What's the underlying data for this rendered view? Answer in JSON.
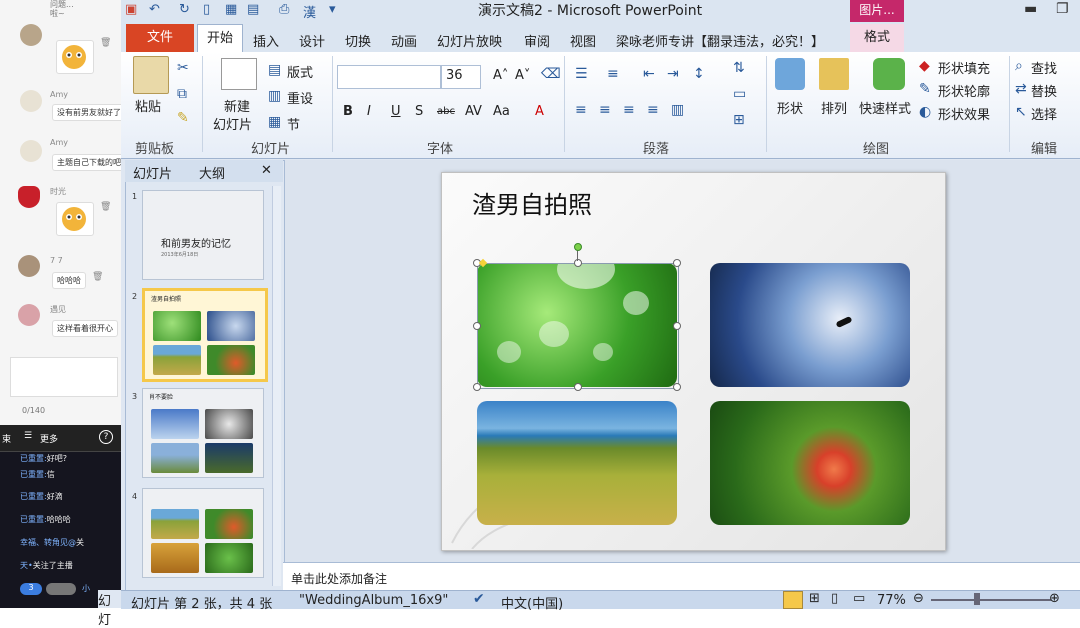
{
  "chat": {
    "top_snippet": [
      "问题...",
      "啦~"
    ],
    "messages": [
      {
        "name": "",
        "text": ""
      },
      {
        "name": "Amy",
        "text": "没有前男友就好了"
      },
      {
        "name": "Amy",
        "text": "主题自己下载的吧"
      },
      {
        "name": "时光",
        "text": ""
      },
      {
        "name": "7 7",
        "text": "哈哈哈"
      },
      {
        "name": "遇见",
        "text": "这样看着很开心"
      }
    ],
    "char_count": "0/140"
  },
  "live": {
    "end_label": "束",
    "more_label": "更多",
    "help_label": "?",
    "lines": [
      {
        "user": "已重置:",
        "text": "好吧?"
      },
      {
        "user": "已重置:",
        "text": "信"
      },
      {
        "user": "已重置:",
        "text": "好滴"
      },
      {
        "user": "已重置:",
        "text": "哈哈哈"
      },
      {
        "user": "幸福、转角见@",
        "text": "关"
      },
      {
        "user": "天•",
        "text": "关注了主播"
      }
    ],
    "badge_a": "3",
    "badge_b": "小"
  },
  "window": {
    "title": "演示文稿2 - Microsoft PowerPoint",
    "contextual_tab": "图片...",
    "pen_char": "漢"
  },
  "tabs": [
    "文件",
    "开始",
    "插入",
    "设计",
    "切换",
    "动画",
    "幻灯片放映",
    "审阅",
    "视图",
    "梁咏老师专讲【翻录违法，必究！】",
    "格式"
  ],
  "ribbon": {
    "paste": "粘贴",
    "clipboard_group": "剪贴板",
    "new_slide": "新建\n幻灯片",
    "new_slide_line1": "新建",
    "new_slide_line2": "幻灯片",
    "layout": "版式",
    "reset": "重设",
    "section": "节",
    "slides_group": "幻灯片",
    "font_size": "36",
    "font_group": "字体",
    "paragraph_group": "段落",
    "shape": "形状",
    "arrange": "排列",
    "quick_styles": "快速样式",
    "shape_fill": "形状填充",
    "shape_outline": "形状轮廓",
    "shape_effects": "形状效果",
    "drawing_group": "绘图",
    "find": "查找",
    "replace": "替换",
    "select": "选择",
    "editing_group": "编辑"
  },
  "pane": {
    "tab_slides": "幻灯片",
    "tab_outline": "大纲",
    "close": "✕",
    "thumbs": [
      {
        "num": "1",
        "title": "和前男友的记忆",
        "sub": "2013年6月18日"
      },
      {
        "num": "2",
        "title": "渣男自拍照"
      },
      {
        "num": "3",
        "title": "肖不要脸"
      },
      {
        "num": "4",
        "title": ""
      }
    ]
  },
  "slide": {
    "title": "渣男自拍照"
  },
  "notes_placeholder": "单击此处添加备注",
  "status": {
    "slide_info": "幻灯片 第 2 张，共 4 张",
    "theme": "\"WeddingAlbum_16x9\"",
    "language": "中文(中国)",
    "zoom": "77%",
    "left_tail": "幻灯"
  },
  "colors": {
    "file_tab": "#d94524",
    "picture_tools": "#c5286a",
    "selection_gold": "#f5c84a"
  }
}
